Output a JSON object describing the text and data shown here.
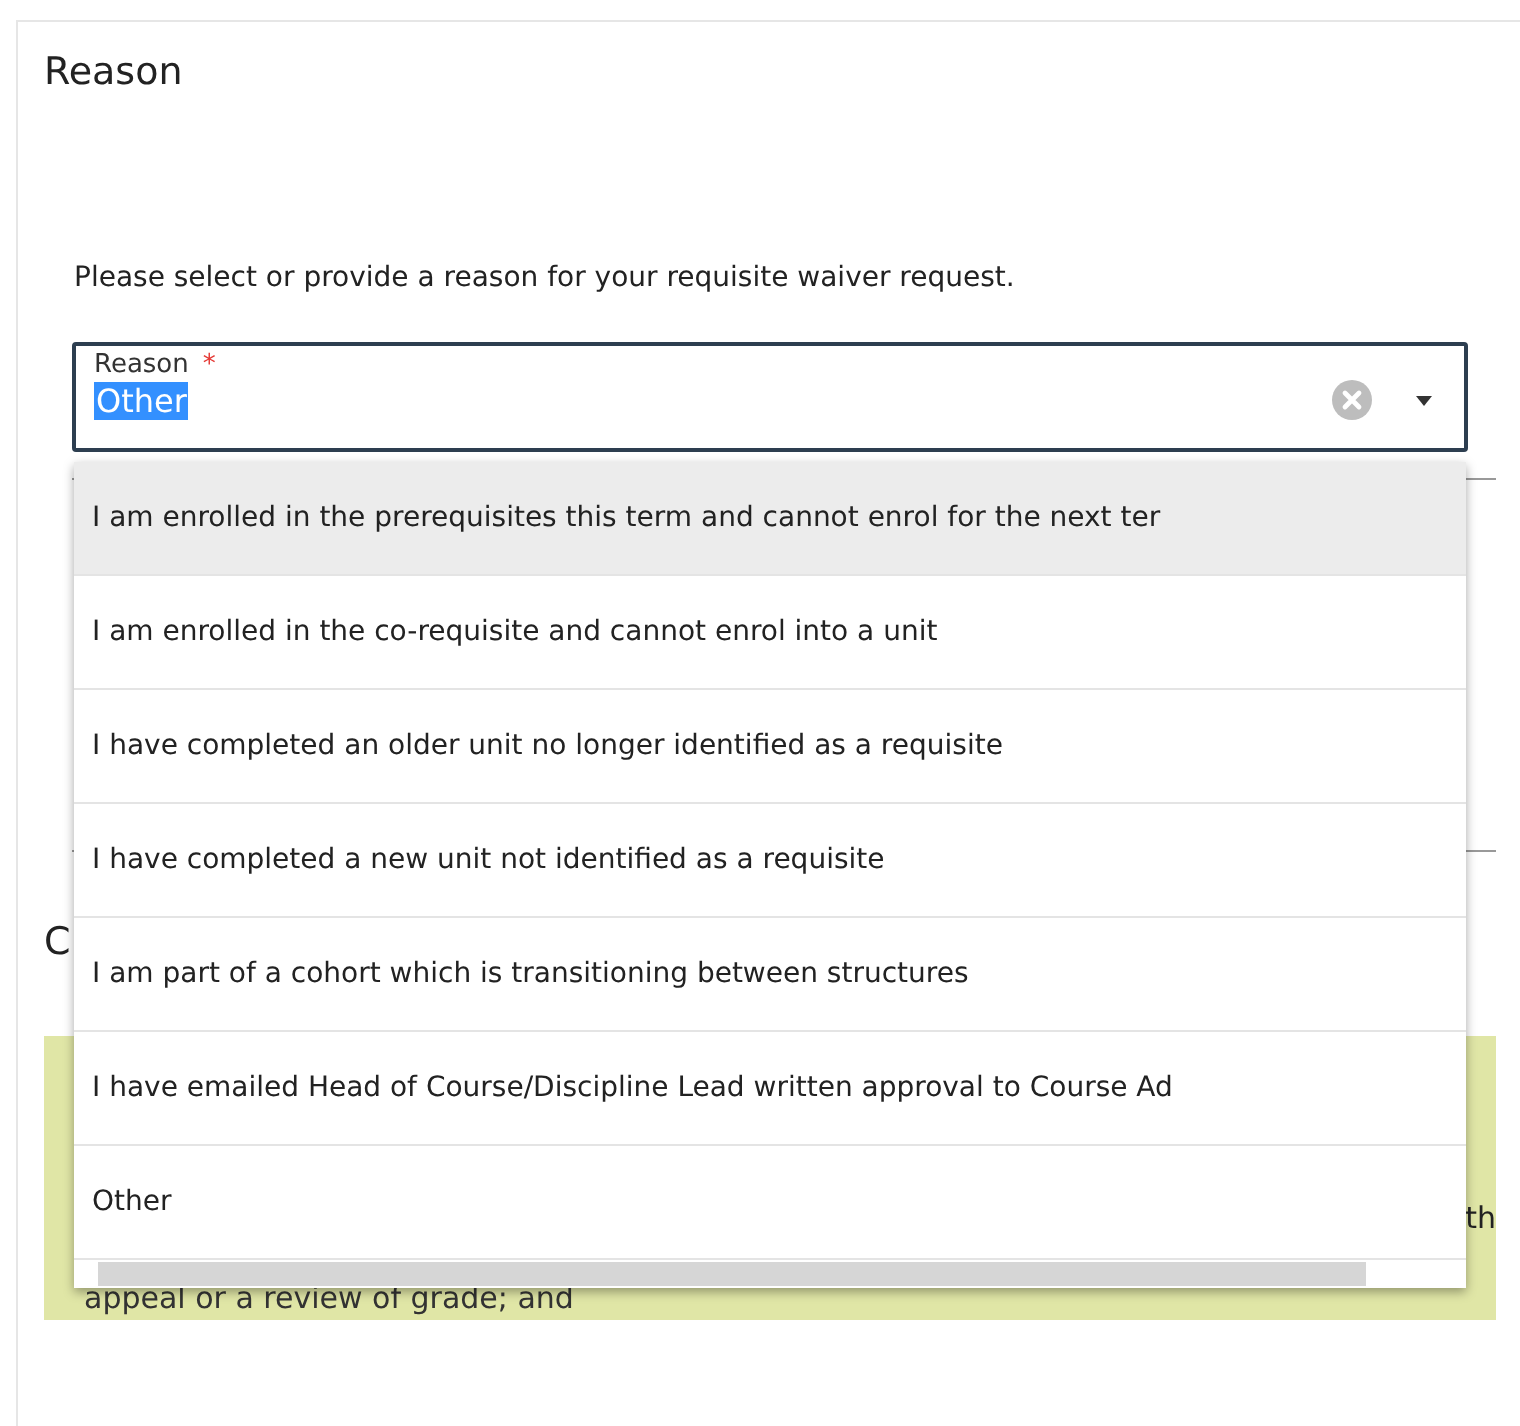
{
  "section": {
    "title": "Reason",
    "instruction": "Please select or provide a reason for your requisite waiver request."
  },
  "field": {
    "label": "Reason",
    "required_mark": "*",
    "value": "Other",
    "value_highlighted": true
  },
  "dropdown": {
    "options": [
      {
        "label": "I am enrolled in the prerequisites this term and cannot enrol for the next ter",
        "focused": true
      },
      {
        "label": "I am enrolled in the co-requisite and cannot enrol into a unit",
        "focused": false
      },
      {
        "label": "I have completed an older unit no longer identified as a requisite",
        "focused": false
      },
      {
        "label": "I have completed a new unit not identified as a requisite",
        "focused": false
      },
      {
        "label": "I am part of a cohort which is transitioning between structures",
        "focused": false
      },
      {
        "label": "I have emailed Head of Course/Discipline Lead written approval to Course Ad",
        "focused": false
      },
      {
        "label": "Other",
        "focused": false
      }
    ]
  },
  "behind": {
    "heading": "C",
    "notice_fragment": "th",
    "notice_last_line": "appeal or a review of grade; and"
  }
}
